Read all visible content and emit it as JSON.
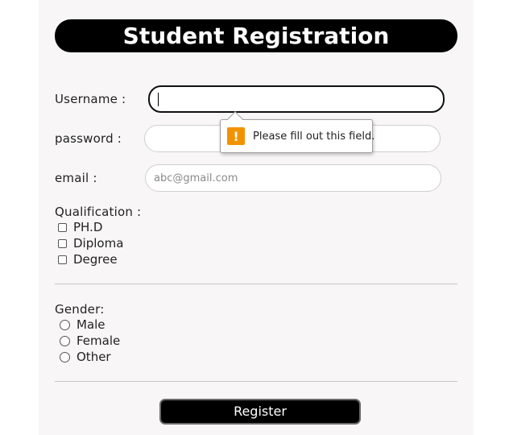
{
  "form": {
    "title": "Student Registration",
    "username": {
      "label": "Username :",
      "value": "",
      "placeholder": ""
    },
    "password": {
      "label": "password :",
      "value": "",
      "placeholder": ""
    },
    "email": {
      "label": "email :",
      "value": "",
      "placeholder": "abc@gmail.com"
    },
    "qualification": {
      "label": "Qualification :",
      "options": [
        "PH.D",
        "Diploma",
        "Degree"
      ]
    },
    "gender": {
      "label": "Gender:",
      "options": [
        "Male",
        "Female",
        "Other"
      ]
    },
    "register_label": "Register"
  },
  "validation_tooltip": {
    "icon": "warning-icon",
    "icon_glyph": "!",
    "message": "Please fill out this field.",
    "icon_color": "#f39200"
  },
  "colors": {
    "title_background": "#000000",
    "panel_background": "#f8f6f7",
    "button_background": "#000000"
  }
}
